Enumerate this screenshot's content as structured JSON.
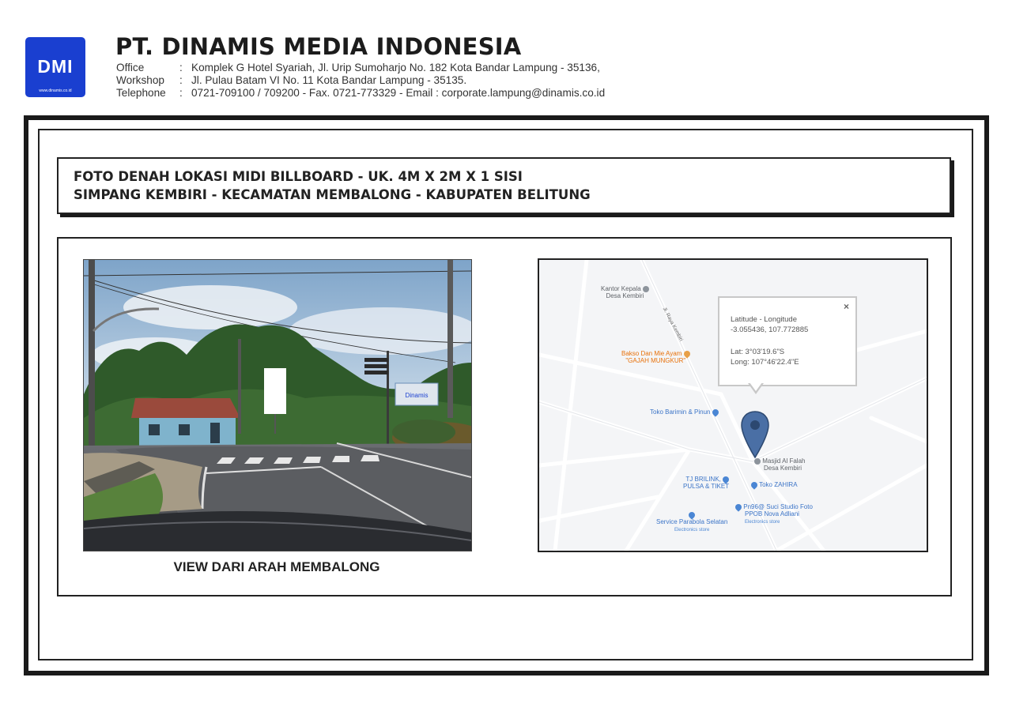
{
  "header": {
    "logo_text": "DMI",
    "logo_url": "www.dinamis.co.id",
    "company": "PT. DINAMIS MEDIA INDONESIA",
    "rows": [
      {
        "label": "Office",
        "sep": ":",
        "value": "Komplek G Hotel Syariah, Jl. Urip  Sumoharjo No. 182 Kota Bandar Lampung - 35136,"
      },
      {
        "label": "Workshop",
        "sep": ":",
        "value": "Jl. Pulau Batam  VI  No. 11 Kota Bandar Lampung - 35135."
      },
      {
        "label": "Telephone",
        "sep": ":",
        "value": "0721-709100 / 709200 - Fax. 0721-773329 - Email : corporate.lampung@dinamis.co.id"
      }
    ],
    "logo_color": "#1a3fd0"
  },
  "title": {
    "line1": "FOTO DENAH LOKASI MIDI BILLBOARD - UK. 4M X 2M X 1 SISI",
    "line2": "SIMPANG KEMBIRI - KECAMATAN MEMBALONG - KABUPATEN BELITUNG"
  },
  "photo": {
    "caption": "VIEW DARI ARAH MEMBALONG",
    "sign_text": "Dinamis"
  },
  "map": {
    "callout": {
      "line1": "Latitude - Longitude",
      "line2": "-3.055436, 107.772885",
      "line3": "Lat: 3°03'19.6\"S",
      "line4": "Long: 107°46'22.4\"E",
      "close": "×"
    },
    "road_label": "Jl. Raya Kembiri",
    "pois": {
      "kantor_1": "Kantor Kepala",
      "kantor_2": "Desa Kembiri",
      "bakso_1": "Bakso Dan Mie Ayam",
      "bakso_2": "\"GAJAH MUNGKUR\"",
      "barimin": "Toko Barimin & Pinun",
      "masjid_1": "Masjid Al Falah",
      "masjid_2": "Desa Kembiri",
      "brilink_1": "TJ BRILINK,",
      "brilink_2": "PULSA & TIKET",
      "zahira": "Toko ZAHIRA",
      "suci_1": "Pn96@ Suci Studio Foto",
      "suci_2": "PPOB Nova Adliani",
      "suci_3": "Electronics store",
      "parabola_1": "Service Parabola Selatan",
      "parabola_2": "Electronics store"
    },
    "pin_color": "#4a6fa5"
  }
}
